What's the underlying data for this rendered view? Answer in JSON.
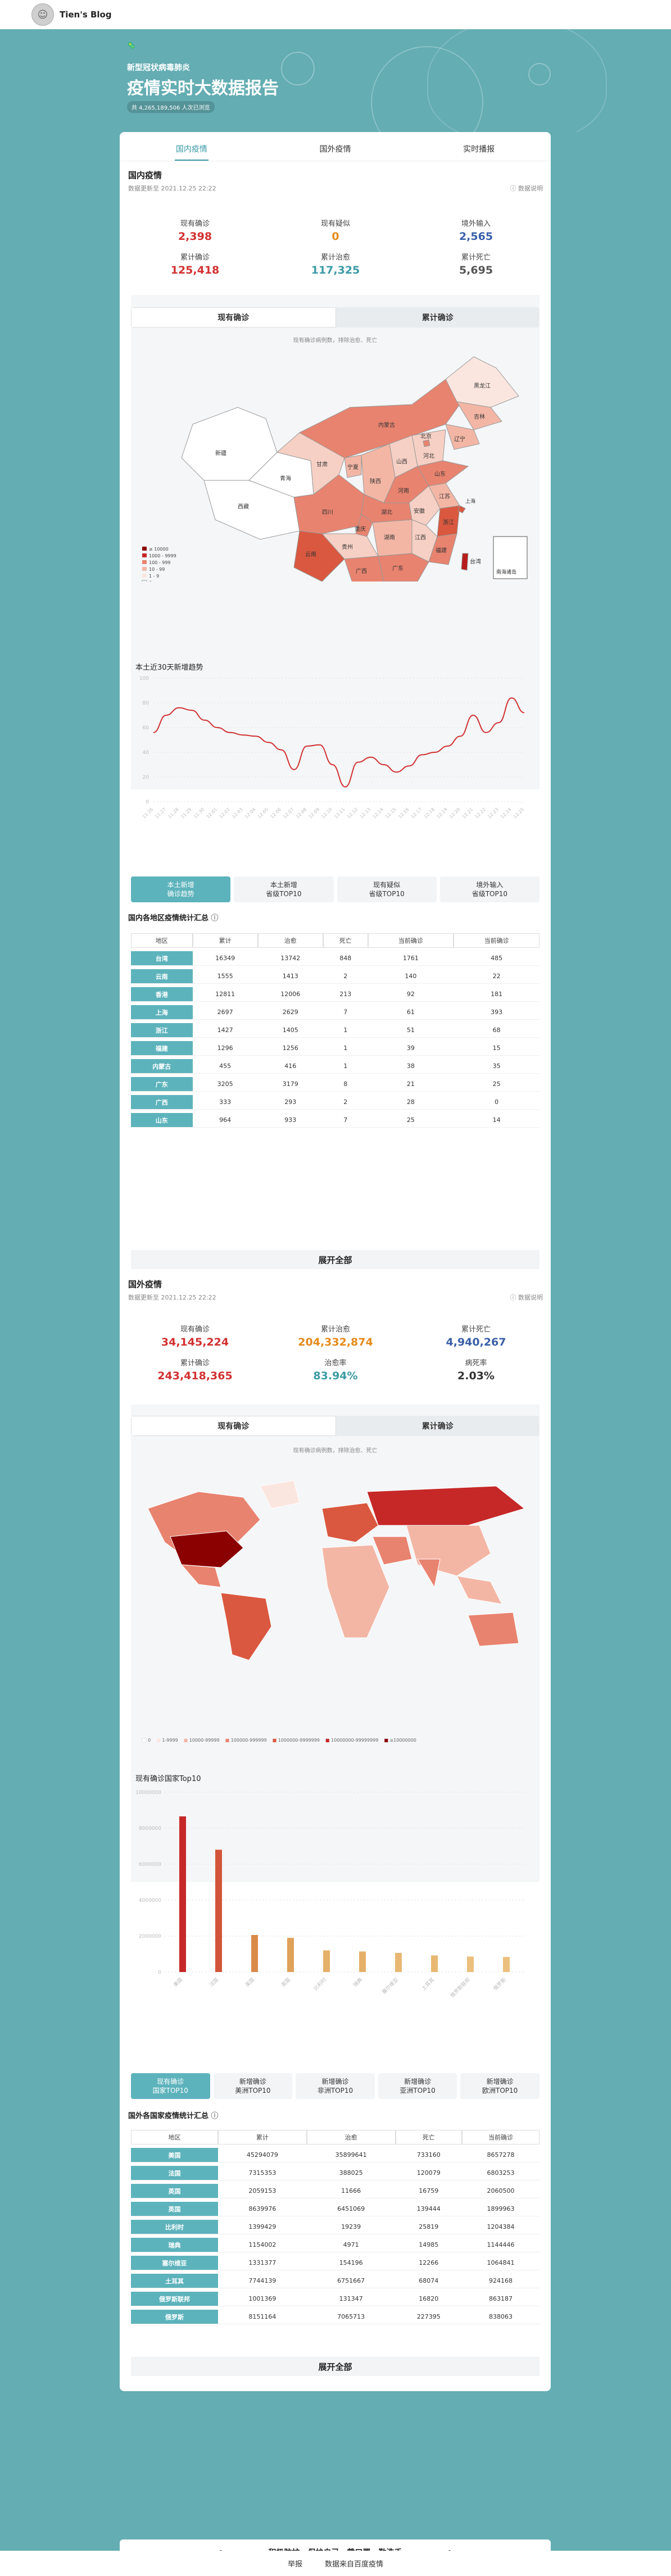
{
  "blog": {
    "name": "Tien's Blog"
  },
  "hero": {
    "tag": "🦠",
    "subtitle": "新型冠状病毒肺炎",
    "title": "疫情实时大数据报告",
    "badge": "共 4,265,189,506 人次已浏览"
  },
  "tabs": [
    {
      "label": "国内疫情"
    },
    {
      "label": "国外疫情"
    },
    {
      "label": "实时播报"
    }
  ],
  "domestic": {
    "title": "国内疫情",
    "update": "数据更新至 2021.12.25 22:22",
    "explain": "数据说明",
    "stats": [
      {
        "label": "现有确诊",
        "value": "2,398",
        "color": "#d23030"
      },
      {
        "label": "现有疑似",
        "value": "0",
        "color": "#e68a1a"
      },
      {
        "label": "境外输入",
        "value": "2,565",
        "color": "#3a5fa8"
      },
      {
        "label": "累计确诊",
        "value": "125,418",
        "color": "#d23030"
      },
      {
        "label": "累计治愈",
        "value": "117,325",
        "color": "#3a9aa5"
      },
      {
        "label": "累计死亡",
        "value": "5,695",
        "color": "#555555"
      }
    ],
    "map_switch": [
      "现有确诊",
      "累计确诊"
    ],
    "map_note": "现有确诊病例数，排除治愈、死亡",
    "map_legend": [
      "≥ 10000",
      "1000 - 9999",
      "100 - 999",
      "10 - 99",
      "1 - 9",
      "0"
    ],
    "south_sea": "南海诸岛",
    "provinces": [
      "新疆",
      "西藏",
      "青海",
      "甘肃",
      "四川",
      "云南",
      "内蒙古",
      "黑龙江",
      "吉林",
      "辽宁",
      "北京",
      "河北",
      "山西",
      "陕西",
      "宁夏",
      "河南",
      "山东",
      "湖北",
      "安徽",
      "江苏",
      "重庆",
      "贵州",
      "湖南",
      "江西",
      "浙江",
      "福建",
      "广西",
      "广东",
      "台湾",
      "海南",
      "上海"
    ],
    "trend_title": "本土近30天新增趋势",
    "buttons": [
      "本土新增\n确诊趋势",
      "本土新增\n省级TOP10",
      "现有疑似\n省级TOP10",
      "境外输入\n省级TOP10"
    ],
    "table_title": "国内各地区疫情统计汇总",
    "table_headers": [
      "地区",
      "累计",
      "治愈",
      "死亡",
      "当前确诊",
      "当前确诊"
    ],
    "table_rows": [
      [
        "台湾",
        "16349",
        "13742",
        "848",
        "1761",
        "485"
      ],
      [
        "云南",
        "1555",
        "1413",
        "2",
        "140",
        "22"
      ],
      [
        "香港",
        "12811",
        "12006",
        "213",
        "92",
        "181"
      ],
      [
        "上海",
        "2697",
        "2629",
        "7",
        "61",
        "393"
      ],
      [
        "浙江",
        "1427",
        "1405",
        "1",
        "51",
        "68"
      ],
      [
        "福建",
        "1296",
        "1256",
        "1",
        "39",
        "15"
      ],
      [
        "内蒙古",
        "455",
        "416",
        "1",
        "38",
        "35"
      ],
      [
        "广东",
        "3205",
        "3179",
        "8",
        "21",
        "25"
      ],
      [
        "广西",
        "333",
        "293",
        "2",
        "28",
        "0"
      ],
      [
        "山东",
        "964",
        "933",
        "7",
        "25",
        "14"
      ]
    ],
    "expand": "展开全部"
  },
  "foreign": {
    "title": "国外疫情",
    "update": "数据更新至 2021.12.25 22:22",
    "explain": "数据说明",
    "stats": [
      {
        "label": "现有确诊",
        "value": "34,145,224",
        "color": "#d23030"
      },
      {
        "label": "累计治愈",
        "value": "204,332,874",
        "color": "#e68a1a"
      },
      {
        "label": "累计死亡",
        "value": "4,940,267",
        "color": "#3a5fa8"
      },
      {
        "label": "累计确诊",
        "value": "243,418,365",
        "color": "#d23030"
      },
      {
        "label": "治愈率",
        "value": "83.94%",
        "color": "#3a9aa5"
      },
      {
        "label": "病死率",
        "value": "2.03%",
        "color": "#333333"
      }
    ],
    "map_switch": [
      "现有确诊",
      "累计确诊"
    ],
    "map_note": "现有确诊病例数，排除治愈、死亡",
    "map_legend": [
      "0",
      "1-9999",
      "10000-99999",
      "100000-999999",
      "1000000-9999999",
      "10000000-99999999",
      "≥10000000"
    ],
    "top_title": "现有确诊国家Top10",
    "buttons": [
      "现有确诊\n国家TOP10",
      "新增确诊\n美洲TOP10",
      "新增确诊\n非洲TOP10",
      "新增确诊\n亚洲TOP10",
      "新增确诊\n欧洲TOP10"
    ],
    "table_title": "国外各国家疫情统计汇总",
    "table_headers": [
      "地区",
      "累计",
      "治愈",
      "死亡",
      "当前确诊"
    ],
    "table_rows": [
      [
        "美国",
        "45294079",
        "35899641",
        "733160",
        "8657278"
      ],
      [
        "法国",
        "7315353",
        "388025",
        "120079",
        "6803253"
      ],
      [
        "英国",
        "2059153",
        "11666",
        "16759",
        "2060500"
      ],
      [
        "英国",
        "8639976",
        "6451069",
        "139444",
        "1899963"
      ],
      [
        "比利时",
        "1399429",
        "19239",
        "25819",
        "1204384"
      ],
      [
        "瑞典",
        "1154002",
        "4971",
        "14985",
        "1144446"
      ],
      [
        "塞尔维亚",
        "1331377",
        "154196",
        "12266",
        "1064841"
      ],
      [
        "土耳其",
        "7744139",
        "6751667",
        "68074",
        "924168"
      ],
      [
        "俄罗斯联邦",
        "1001369",
        "131347",
        "16820",
        "863187"
      ],
      [
        "俄罗斯",
        "8151164",
        "7065713",
        "227395",
        "838063"
      ]
    ],
    "expand": "展开全部"
  },
  "chart_data": [
    {
      "type": "line",
      "title": "本土近30天新增趋势",
      "x": [
        "11.26",
        "11.27",
        "11.28",
        "11.29",
        "11.30",
        "12.01",
        "12.02",
        "12.03",
        "12.04",
        "12.05",
        "12.06",
        "12.07",
        "12.08",
        "12.09",
        "12.10",
        "12.11",
        "12.12",
        "12.13",
        "12.14",
        "12.15",
        "12.16",
        "12.17",
        "12.18",
        "12.19",
        "12.20",
        "12.21",
        "12.22",
        "12.23",
        "12.24",
        "12.25"
      ],
      "series": [
        {
          "values": [
            56,
            70,
            76,
            74,
            66,
            60,
            56,
            54,
            53,
            48,
            42,
            26,
            45,
            46,
            30,
            12,
            32,
            36,
            30,
            24,
            29,
            38,
            40,
            45,
            53,
            70,
            56,
            64,
            84,
            72
          ]
        }
      ],
      "ylim": [
        0,
        100
      ],
      "yticks": [
        0,
        20,
        40,
        60,
        80,
        100
      ],
      "color": "#d23030"
    },
    {
      "type": "bar",
      "title": "现有确诊国家Top10",
      "categories": [
        "美国",
        "法国",
        "英国",
        "英国",
        "比利时",
        "瑞典",
        "塞尔维亚",
        "土耳其",
        "俄罗斯联邦",
        "俄罗斯"
      ],
      "values": [
        8657278,
        6803253,
        2060500,
        1899963,
        1204384,
        1144446,
        1064841,
        924168,
        863187,
        838063
      ],
      "ylim": [
        0,
        10000000
      ],
      "yticks": [
        0,
        2000000,
        4000000,
        6000000,
        8000000,
        10000000
      ],
      "colors": [
        "#c62828",
        "#d2553a",
        "#d98a4a",
        "#e0a15a",
        "#e5b06a",
        "#e5b06a",
        "#e8b873",
        "#e8b873",
        "#ebbf7d",
        "#ebbf7d"
      ]
    }
  ],
  "slogan": {
    "text": "积极防护，保护自己，戴口罩，勤洗手",
    "left": "•",
    "right": "•"
  },
  "footer": {
    "links": [
      "举报",
      "数据来自百度疫情"
    ]
  }
}
